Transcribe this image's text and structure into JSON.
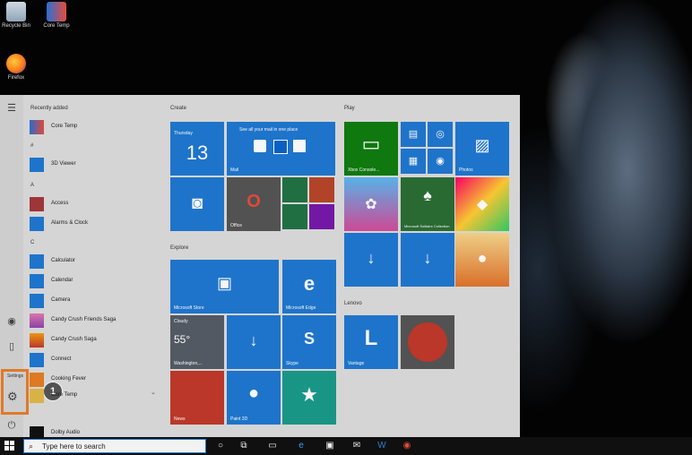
{
  "desktop": {
    "icons": [
      {
        "label": "Recycle Bin"
      },
      {
        "label": "Core Temp"
      },
      {
        "label": "Firefox"
      }
    ]
  },
  "start_menu": {
    "recently_added": "Recently added",
    "settings_tip": "Settings",
    "step_number": "1",
    "sections": {
      "hash": "#",
      "a": "A",
      "c": "C"
    },
    "apps": [
      {
        "label": "Core Temp"
      },
      {
        "label": "3D Viewer"
      },
      {
        "label": "Access"
      },
      {
        "label": "Alarms & Clock"
      },
      {
        "label": "Calculator"
      },
      {
        "label": "Calendar"
      },
      {
        "label": "Camera"
      },
      {
        "label": "Candy Crush Friends Saga"
      },
      {
        "label": "Candy Crush Saga"
      },
      {
        "label": "Connect"
      },
      {
        "label": "Cooking Fever"
      },
      {
        "label": "Core Temp"
      },
      {
        "label": "Dolby Audio"
      }
    ],
    "groups": {
      "create": "Create",
      "play": "Play",
      "explore": "Explore",
      "lenovo": "Lenovo"
    },
    "tiles": {
      "calendar_day": "Thursday",
      "calendar_date": "13",
      "mail_text": "See all your mail in one place",
      "mail_label": "Mail",
      "office_label": "Office",
      "xbox_label": "Xbox Console...",
      "photos_label": "Photos",
      "solitaire_label": "Microsoft Solitaire Collection",
      "store_label": "Microsoft Store",
      "edge_label": "Microsoft Edge",
      "weather_condition": "Cloudy",
      "weather_temp": "55°",
      "weather_label": "Washington,...",
      "skype_label": "Skype",
      "news_label": "News",
      "paint3d_label": "Paint 3D",
      "vantage_label": "Vantage",
      "vantage_letter": "L"
    }
  },
  "taskbar": {
    "search_placeholder": "Type here to search"
  }
}
